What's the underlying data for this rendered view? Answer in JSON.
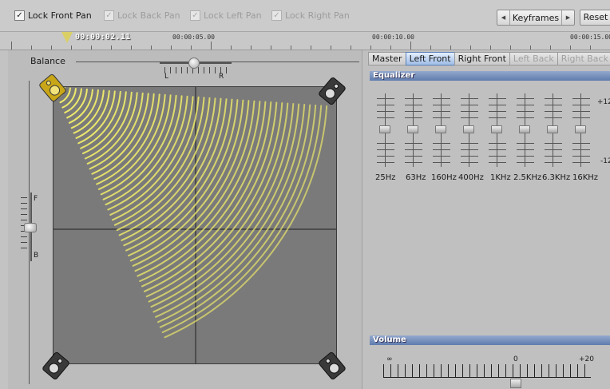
{
  "toolbar": {
    "lock_front": "Lock Front Pan",
    "lock_back": "Lock Back Pan",
    "lock_left": "Lock Left Pan",
    "lock_right": "Lock Right Pan",
    "keyframes": "Keyframes",
    "reset": "Reset"
  },
  "ruler": {
    "current_time": "00:00:02.11",
    "labels": [
      "00:00:05.00",
      "00:00:10.00",
      "00:00:15.00"
    ]
  },
  "panner": {
    "balance_label": "Balance",
    "left": "L",
    "right": "R",
    "front": "F",
    "back": "B"
  },
  "channels": {
    "tabs": [
      "Master",
      "Left Front",
      "Right Front",
      "Left Back",
      "Right Back"
    ],
    "active": "Left Front"
  },
  "equalizer": {
    "title": "Equalizer",
    "scale_top": "+12",
    "scale_bottom": "-12",
    "bands": [
      "25Hz",
      "63Hz",
      "160Hz",
      "400Hz",
      "1KHz",
      "2.5KHz",
      "6.3KHz",
      "16KHz"
    ]
  },
  "volume": {
    "title": "Volume",
    "min": "∞",
    "zero": "0",
    "max": "+20"
  },
  "colors": {
    "wave": "#f2ee6a",
    "active_tab": "#9fbde6",
    "section_header": "#5f7cae"
  }
}
